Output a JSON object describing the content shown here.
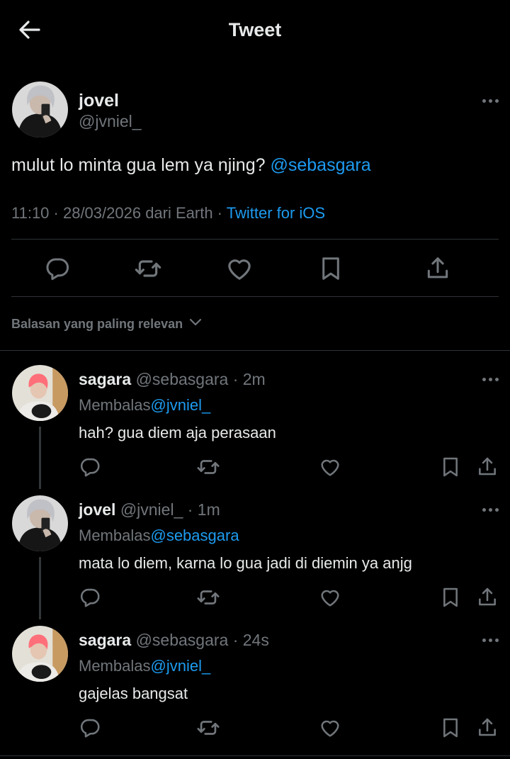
{
  "header": {
    "title": "Tweet",
    "back_icon": "arrow-left-icon"
  },
  "main_tweet": {
    "name": "jovel",
    "handle": "@jvniel_",
    "text": "mulut lo minta gua lem ya njing?",
    "mention": "@sebasgara",
    "meta": "11:10 · 28/03/2026 dari Earth · ",
    "source": "Twitter for iOS",
    "actions": [
      "reply-icon",
      "retweet-icon",
      "like-icon",
      "bookmark-icon",
      "share-icon"
    ]
  },
  "sort": {
    "label": "Balasan yang paling relevan"
  },
  "replies": [
    {
      "name": "sagara",
      "handle": "@sebasgara · 2m",
      "replying_label": "Membalas",
      "replying_to": "@jvniel_",
      "text": "hah? gua diem aja perasaan"
    },
    {
      "name": "jovel",
      "handle": "@jvniel_ · 1m",
      "replying_label": "Membalas",
      "replying_to": "@sebasgara",
      "text": "mata lo diem, karna lo gua jadi di diemin ya anjg"
    },
    {
      "name": "sagara",
      "handle": "@sebasgara · 24s",
      "replying_label": "Membalas",
      "replying_to": "@jvniel_",
      "text": "gajelas bangsat"
    }
  ],
  "colors": {
    "background": "#000000",
    "text": "#e7e9ea",
    "muted": "#71767b",
    "link": "#1d9bf0",
    "divider": "#2f3336"
  }
}
